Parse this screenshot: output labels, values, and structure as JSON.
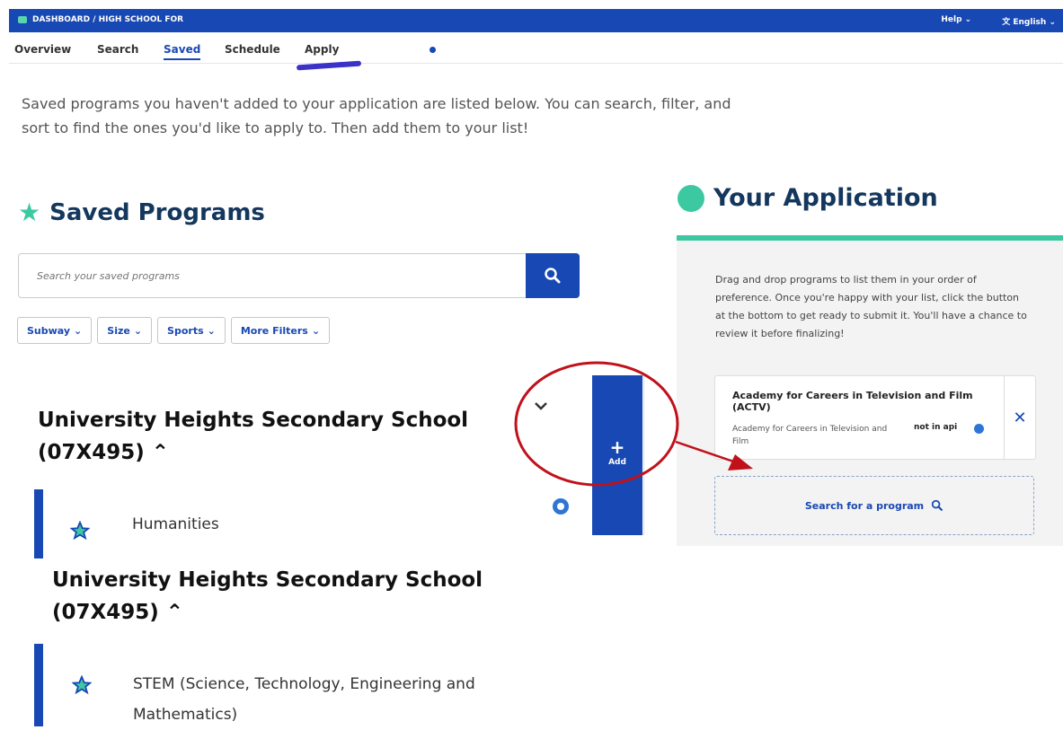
{
  "topbar": {
    "breadcrumb": "DASHBOARD / HIGH SCHOOL FOR",
    "help": "Help",
    "language": "English"
  },
  "tabs": [
    "Overview",
    "Search",
    "Saved",
    "Schedule",
    "Apply"
  ],
  "intro": "Saved programs you haven't added to your application are listed below. You can search, filter, and sort to find the ones you'd like to apply to. Then add them to your list!",
  "saved": {
    "title": "Saved Programs",
    "search_placeholder": "Search your saved programs",
    "filters": [
      "Subway",
      "Size",
      "Sports",
      "More Filters"
    ]
  },
  "programs": [
    {
      "school_line1": "University Heights Secondary School",
      "school_line2": "(07X495)",
      "program": "Humanities"
    },
    {
      "school_line1": "University Heights Secondary School",
      "school_line2": "(07X495)",
      "program_line1": "STEM (Science, Technology, Engineering and",
      "program_line2": "Mathematics)"
    }
  ],
  "add_button": {
    "label": "Add"
  },
  "application": {
    "title": "Your Application",
    "description": "Drag and drop programs to list them in your order of preference. Once you're happy with your list, click the button at the bottom to get ready to submit it. You'll have a chance to review it before finalizing!",
    "card": {
      "name": "Academy for Careers in Television and Film (ACTV)",
      "subtitle": "Academy for Careers in Television and Film",
      "status": "not in api"
    },
    "search_program": "Search for a program"
  },
  "colors": {
    "brand_blue": "#1848b3",
    "accent_green": "#3cc9a2",
    "heading_navy": "#14375e",
    "annotation_red": "#c0111b"
  }
}
